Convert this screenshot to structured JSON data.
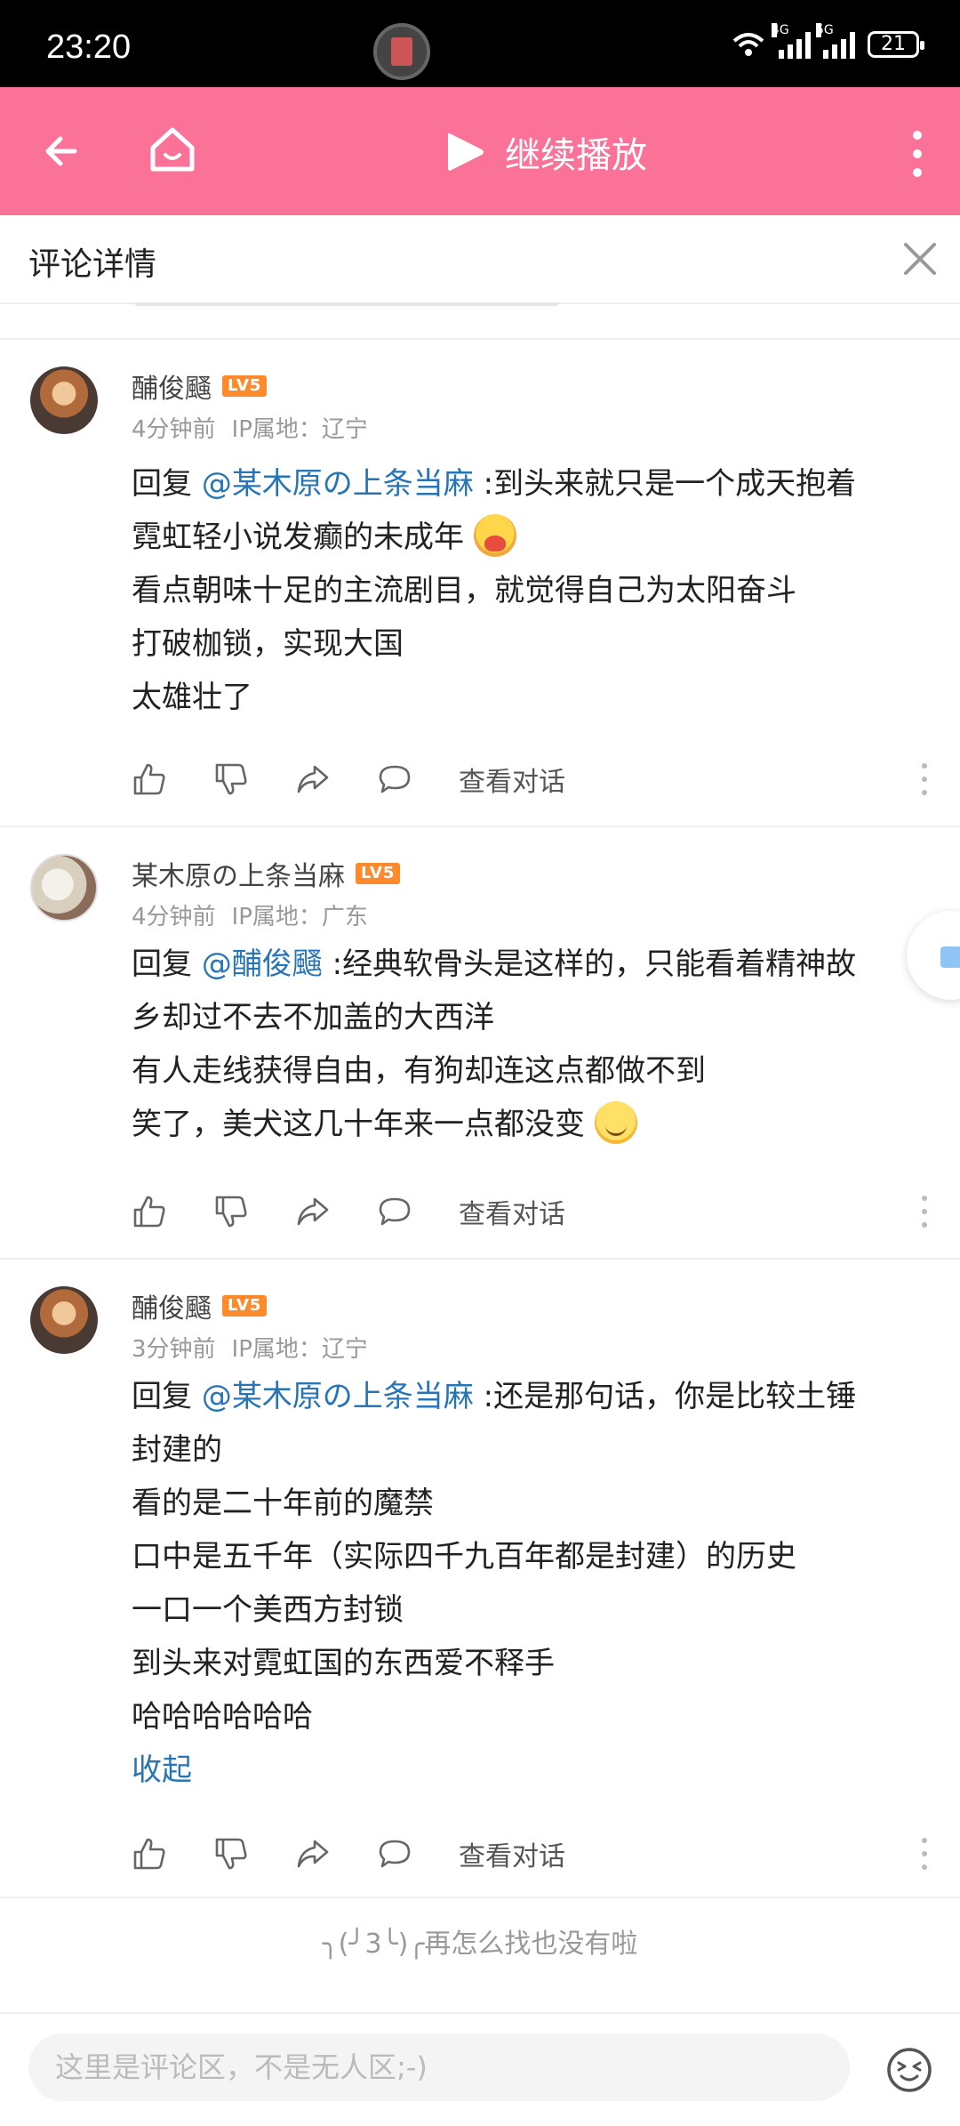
{
  "status_bar": {
    "time": "23:20",
    "battery": "21",
    "net1": "4G",
    "net2": "5G"
  },
  "top_bar": {
    "play_label": "继续播放",
    "accent_color": "#fb7299"
  },
  "sub_header": {
    "title": "评论详情"
  },
  "comments": [
    {
      "user": "酺俊颾",
      "level": "LV5",
      "time": "4分钟前",
      "ip": "IP属地：辽宁",
      "reply_prefix": "回复 ",
      "mention": "@某木原の上条当麻",
      "lines": [
        ":到头来就只是一个成天抱着",
        "霓虹轻小说发癫的未成年",
        "看点朝味十足的主流剧目，就觉得自己为太阳奋斗",
        "打破枷锁，实现大国",
        "太雄壮了"
      ],
      "view_conversation": "查看对话"
    },
    {
      "user": "某木原の上条当麻",
      "level": "LV5",
      "time": "4分钟前",
      "ip": "IP属地：广东",
      "reply_prefix": "回复 ",
      "mention": "@酺俊颾",
      "lines": [
        ":经典软骨头是这样的，只能看着精神故",
        "乡却过不去不加盖的大西洋",
        "有人走线获得自由，有狗却连这点都做不到",
        "笑了，美犬这几十年来一点都没变"
      ],
      "view_conversation": "查看对话"
    },
    {
      "user": "酺俊颾",
      "level": "LV5",
      "time": "3分钟前",
      "ip": "IP属地：辽宁",
      "reply_prefix": "回复 ",
      "mention": "@某木原の上条当麻",
      "lines": [
        ":还是那句话，你是比较土锤",
        "封建的",
        "看的是二十年前的魔禁",
        "口中是五千年（实际四千九百年都是封建）的历史",
        "一口一个美西方封锁",
        "到头来对霓虹国的东西爱不释手",
        "哈哈哈哈哈哈"
      ],
      "fold_label": "收起",
      "view_conversation": "查看对话"
    }
  ],
  "end_text": "╮(╯3╰)╭再怎么找也没有啦",
  "input": {
    "placeholder": "这里是评论区，不是无人区;-)"
  }
}
